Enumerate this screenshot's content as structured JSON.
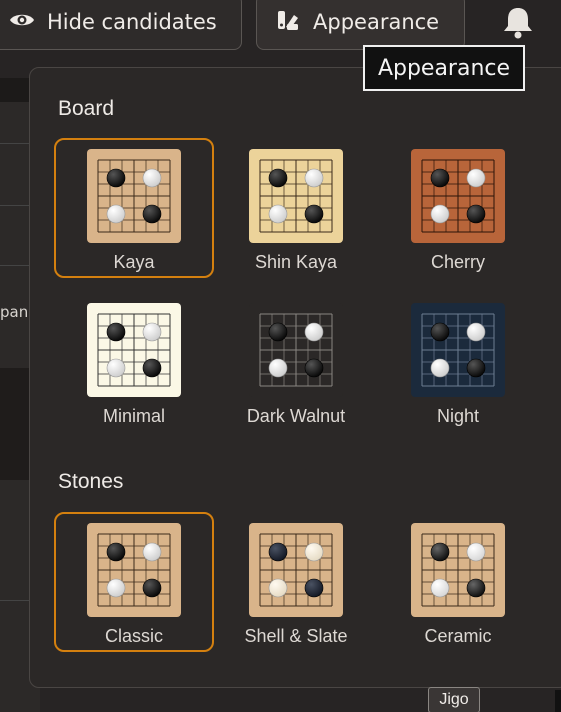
{
  "toolbar": {
    "hide_candidates_label": "Hide candidates",
    "appearance_label": "Appearance"
  },
  "tooltip": {
    "text": "Appearance"
  },
  "background": {
    "partial_text": "pan"
  },
  "appearance_panel": {
    "board_title": "Board",
    "stones_title": "Stones",
    "boards": [
      {
        "label": "Kaya",
        "selected": true,
        "bg": "#d9b48a",
        "line": "#3a2a1a"
      },
      {
        "label": "Shin Kaya",
        "selected": false,
        "bg": "#ecd39a",
        "line": "#3a2a1a"
      },
      {
        "label": "Cherry",
        "selected": false,
        "bg": "#b8653a",
        "line": "#2a1408"
      },
      {
        "label": "Minimal",
        "selected": false,
        "bg": "#fbf8e6",
        "line": "#333333"
      },
      {
        "label": "Dark Walnut",
        "selected": false,
        "bg": "#2b2827",
        "line": "#8a8682"
      },
      {
        "label": "Night",
        "selected": false,
        "bg": "#1b2a3c",
        "line": "#6d7d92"
      }
    ],
    "stones": [
      {
        "label": "Classic",
        "selected": true,
        "style": "classic"
      },
      {
        "label": "Shell & Slate",
        "selected": false,
        "style": "shell-slate"
      },
      {
        "label": "Ceramic",
        "selected": false,
        "style": "ceramic"
      }
    ]
  },
  "status": {
    "jigo_label": "Jigo"
  }
}
